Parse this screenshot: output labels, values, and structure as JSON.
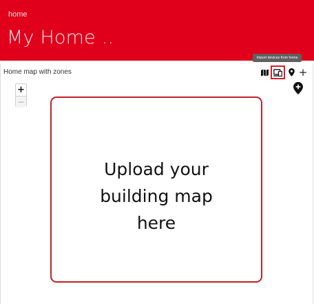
{
  "header": {
    "breadcrumb": "home",
    "title": "My Home ..",
    "background_color": "#e0001b"
  },
  "card": {
    "title": "Home map with zones"
  },
  "toolbar": {
    "tooltip": "Import devices from home",
    "icons": [
      "map-icon",
      "import-devices-icon",
      "location-pin-icon",
      "plus-icon"
    ],
    "add_label": "+",
    "highlight_color": "#d81e2a"
  },
  "map": {
    "zoom_in_label": "+",
    "zoom_out_label": "−",
    "upload_lines": [
      "Upload your",
      "building map",
      "here"
    ],
    "placeholder_border_color": "#c0202a"
  }
}
